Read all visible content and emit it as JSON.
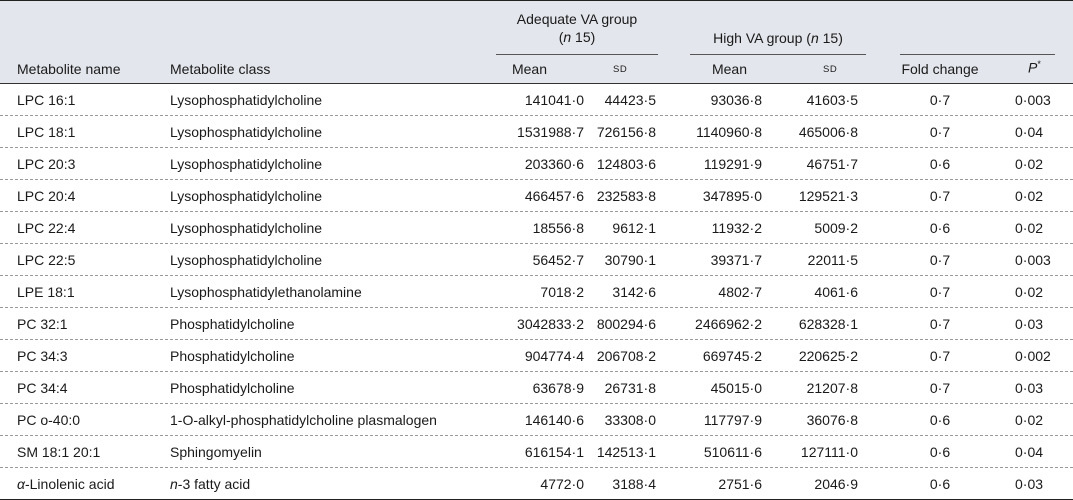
{
  "header": {
    "metabolite_name": "Metabolite name",
    "metabolite_class": "Metabolite class",
    "group_adequate": "Adequate VA group",
    "group_adequate_n": "(n 15)",
    "group_high": "High VA group (n 15)",
    "mean": "Mean",
    "sd": "SD",
    "fold_change": "Fold change",
    "p_label": "P",
    "p_mark": "*"
  },
  "rows": [
    {
      "name": "LPC 16:1",
      "class": "Lysophosphatidylcholine",
      "adq_mean": "141041·0",
      "adq_sd": "44423·5",
      "high_mean": "93036·8",
      "high_sd": "41603·5",
      "fold": "0·7",
      "p": "0·003"
    },
    {
      "name": "LPC 18:1",
      "class": "Lysophosphatidylcholine",
      "adq_mean": "1531988·7",
      "adq_sd": "726156·8",
      "high_mean": "1140960·8",
      "high_sd": "465006·8",
      "fold": "0·7",
      "p": "0·04"
    },
    {
      "name": "LPC 20:3",
      "class": "Lysophosphatidylcholine",
      "adq_mean": "203360·6",
      "adq_sd": "124803·6",
      "high_mean": "119291·9",
      "high_sd": "46751·7",
      "fold": "0·6",
      "p": "0·02"
    },
    {
      "name": "LPC 20:4",
      "class": "Lysophosphatidylcholine",
      "adq_mean": "466457·6",
      "adq_sd": "232583·8",
      "high_mean": "347895·0",
      "high_sd": "129521·3",
      "fold": "0·7",
      "p": "0·02"
    },
    {
      "name": "LPC 22:4",
      "class": "Lysophosphatidylcholine",
      "adq_mean": "18556·8",
      "adq_sd": "9612·1",
      "high_mean": "11932·2",
      "high_sd": "5009·2",
      "fold": "0·6",
      "p": "0·02"
    },
    {
      "name": "LPC 22:5",
      "class": "Lysophosphatidylcholine",
      "adq_mean": "56452·7",
      "adq_sd": "30790·1",
      "high_mean": "39371·7",
      "high_sd": "22011·5",
      "fold": "0·7",
      "p": "0·003"
    },
    {
      "name": "LPE 18:1",
      "class": "Lysophosphatidylethanolamine",
      "adq_mean": "7018·2",
      "adq_sd": "3142·6",
      "high_mean": "4802·7",
      "high_sd": "4061·6",
      "fold": "0·7",
      "p": "0·02"
    },
    {
      "name": "PC 32:1",
      "class": "Phosphatidylcholine",
      "adq_mean": "3042833·2",
      "adq_sd": "800294·6",
      "high_mean": "2466962·2",
      "high_sd": "628328·1",
      "fold": "0·7",
      "p": "0·03"
    },
    {
      "name": "PC 34:3",
      "class": "Phosphatidylcholine",
      "adq_mean": "904774·4",
      "adq_sd": "206708·2",
      "high_mean": "669745·2",
      "high_sd": "220625·2",
      "fold": "0·7",
      "p": "0·002"
    },
    {
      "name": "PC 34:4",
      "class": "Phosphatidylcholine",
      "adq_mean": "63678·9",
      "adq_sd": "26731·8",
      "high_mean": "45015·0",
      "high_sd": "21207·8",
      "fold": "0·7",
      "p": "0·03"
    },
    {
      "name": "PC o-40:0",
      "class": "1-O-alkyl-phosphatidylcholine plasmalogen",
      "adq_mean": "146140·6",
      "adq_sd": "33308·0",
      "high_mean": "117797·9",
      "high_sd": "36076·8",
      "fold": "0·6",
      "p": "0·02"
    },
    {
      "name": "SM 18:1 20:1",
      "class": "Sphingomyelin",
      "adq_mean": "616154·1",
      "adq_sd": "142513·1",
      "high_mean": "510611·6",
      "high_sd": "127111·0",
      "fold": "0·6",
      "p": "0·04"
    },
    {
      "name": "α-Linolenic acid",
      "class": "n-3 fatty acid",
      "adq_mean": "4772·0",
      "adq_sd": "3188·4",
      "high_mean": "2751·6",
      "high_sd": "2046·9",
      "fold": "0·6",
      "p": "0·03"
    }
  ]
}
